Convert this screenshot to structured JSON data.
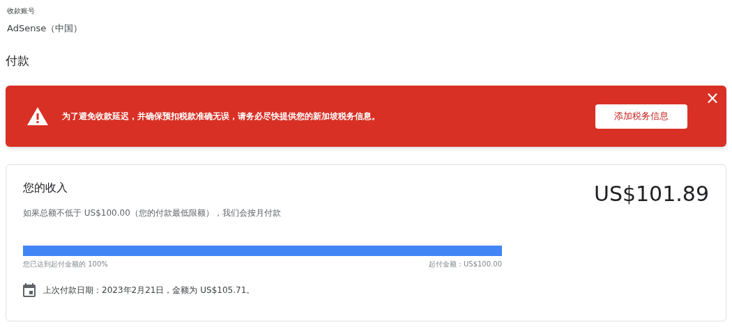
{
  "account": {
    "label": "收款账号",
    "value": "AdSense（中国）"
  },
  "section_title": "付款",
  "alert": {
    "message": "为了避免收款延迟，并确保预扣税款准确无误，请务必尽快提供您的新加坡税务信息。",
    "button": "添加税务信息",
    "close": "×"
  },
  "earnings": {
    "title": "您的收入",
    "amount": "US$101.89",
    "description": "如果总额不低于 US$100.00（您的付款最低限额），我们会按月付款",
    "progress": {
      "level": 1.0,
      "left_label": "您已达到起付金额的 100%",
      "right_label": "起付金额：US$100.00"
    },
    "last_payment": "上次付款日期：2023年2月21日，金额为 US$105.71。"
  }
}
